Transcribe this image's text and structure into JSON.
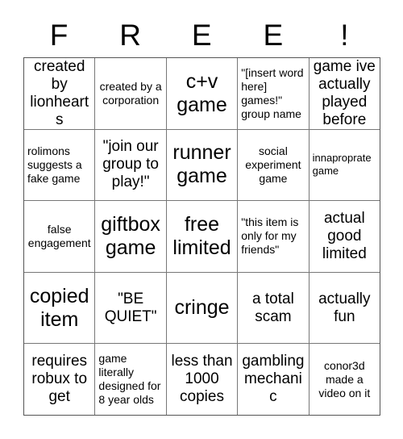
{
  "card": {
    "title_letters": [
      "F",
      "R",
      "E",
      "E",
      "!"
    ],
    "colors": {
      "background": "#ffffff",
      "text": "#000000",
      "grid_line": "#777777",
      "outer_border": "#555555"
    },
    "grid_size": "5x5",
    "rows": [
      {
        "cells": [
          {
            "text": "created by lionhearts",
            "size": "md",
            "align": "center"
          },
          {
            "text": "created by a corporation",
            "size": "sm",
            "align": "center"
          },
          {
            "text": "c+v game",
            "size": "lg",
            "align": "center"
          },
          {
            "text": "\"[insert word here] games!\" group name",
            "size": "sm",
            "align": "left"
          },
          {
            "text": "game ive actually played before",
            "size": "md",
            "align": "center"
          }
        ]
      },
      {
        "cells": [
          {
            "text": "rolimons suggests a fake game",
            "size": "sm",
            "align": "left"
          },
          {
            "text": "\"join our group to play!\"",
            "size": "md",
            "align": "center"
          },
          {
            "text": "runner game",
            "size": "lg",
            "align": "center"
          },
          {
            "text": "social experiment game",
            "size": "sm",
            "align": "center"
          },
          {
            "text": "innaproprate game",
            "size": "xs",
            "align": "left"
          }
        ]
      },
      {
        "cells": [
          {
            "text": "false engagement",
            "size": "sm",
            "align": "center"
          },
          {
            "text": "giftbox game",
            "size": "lg",
            "align": "center"
          },
          {
            "text": "free limited",
            "size": "lg",
            "align": "center"
          },
          {
            "text": "\"this item is only for my friends\"",
            "size": "sm",
            "align": "left"
          },
          {
            "text": "actual good limited",
            "size": "md",
            "align": "center"
          }
        ]
      },
      {
        "cells": [
          {
            "text": "copied item",
            "size": "lg",
            "align": "center"
          },
          {
            "text": "\"BE QUIET\"",
            "size": "md",
            "align": "center"
          },
          {
            "text": "cringe",
            "size": "lg",
            "align": "center"
          },
          {
            "text": "a total scam",
            "size": "md",
            "align": "center"
          },
          {
            "text": "actually fun",
            "size": "md",
            "align": "center"
          }
        ]
      },
      {
        "cells": [
          {
            "text": "requires robux to get",
            "size": "md",
            "align": "center"
          },
          {
            "text": "game literally designed for 8 year olds",
            "size": "sm",
            "align": "left"
          },
          {
            "text": "less than 1000 copies",
            "size": "md",
            "align": "center"
          },
          {
            "text": "gambling mechanic",
            "size": "md",
            "align": "center"
          },
          {
            "text": "conor3d made a video on it",
            "size": "sm",
            "align": "center"
          }
        ]
      }
    ]
  }
}
